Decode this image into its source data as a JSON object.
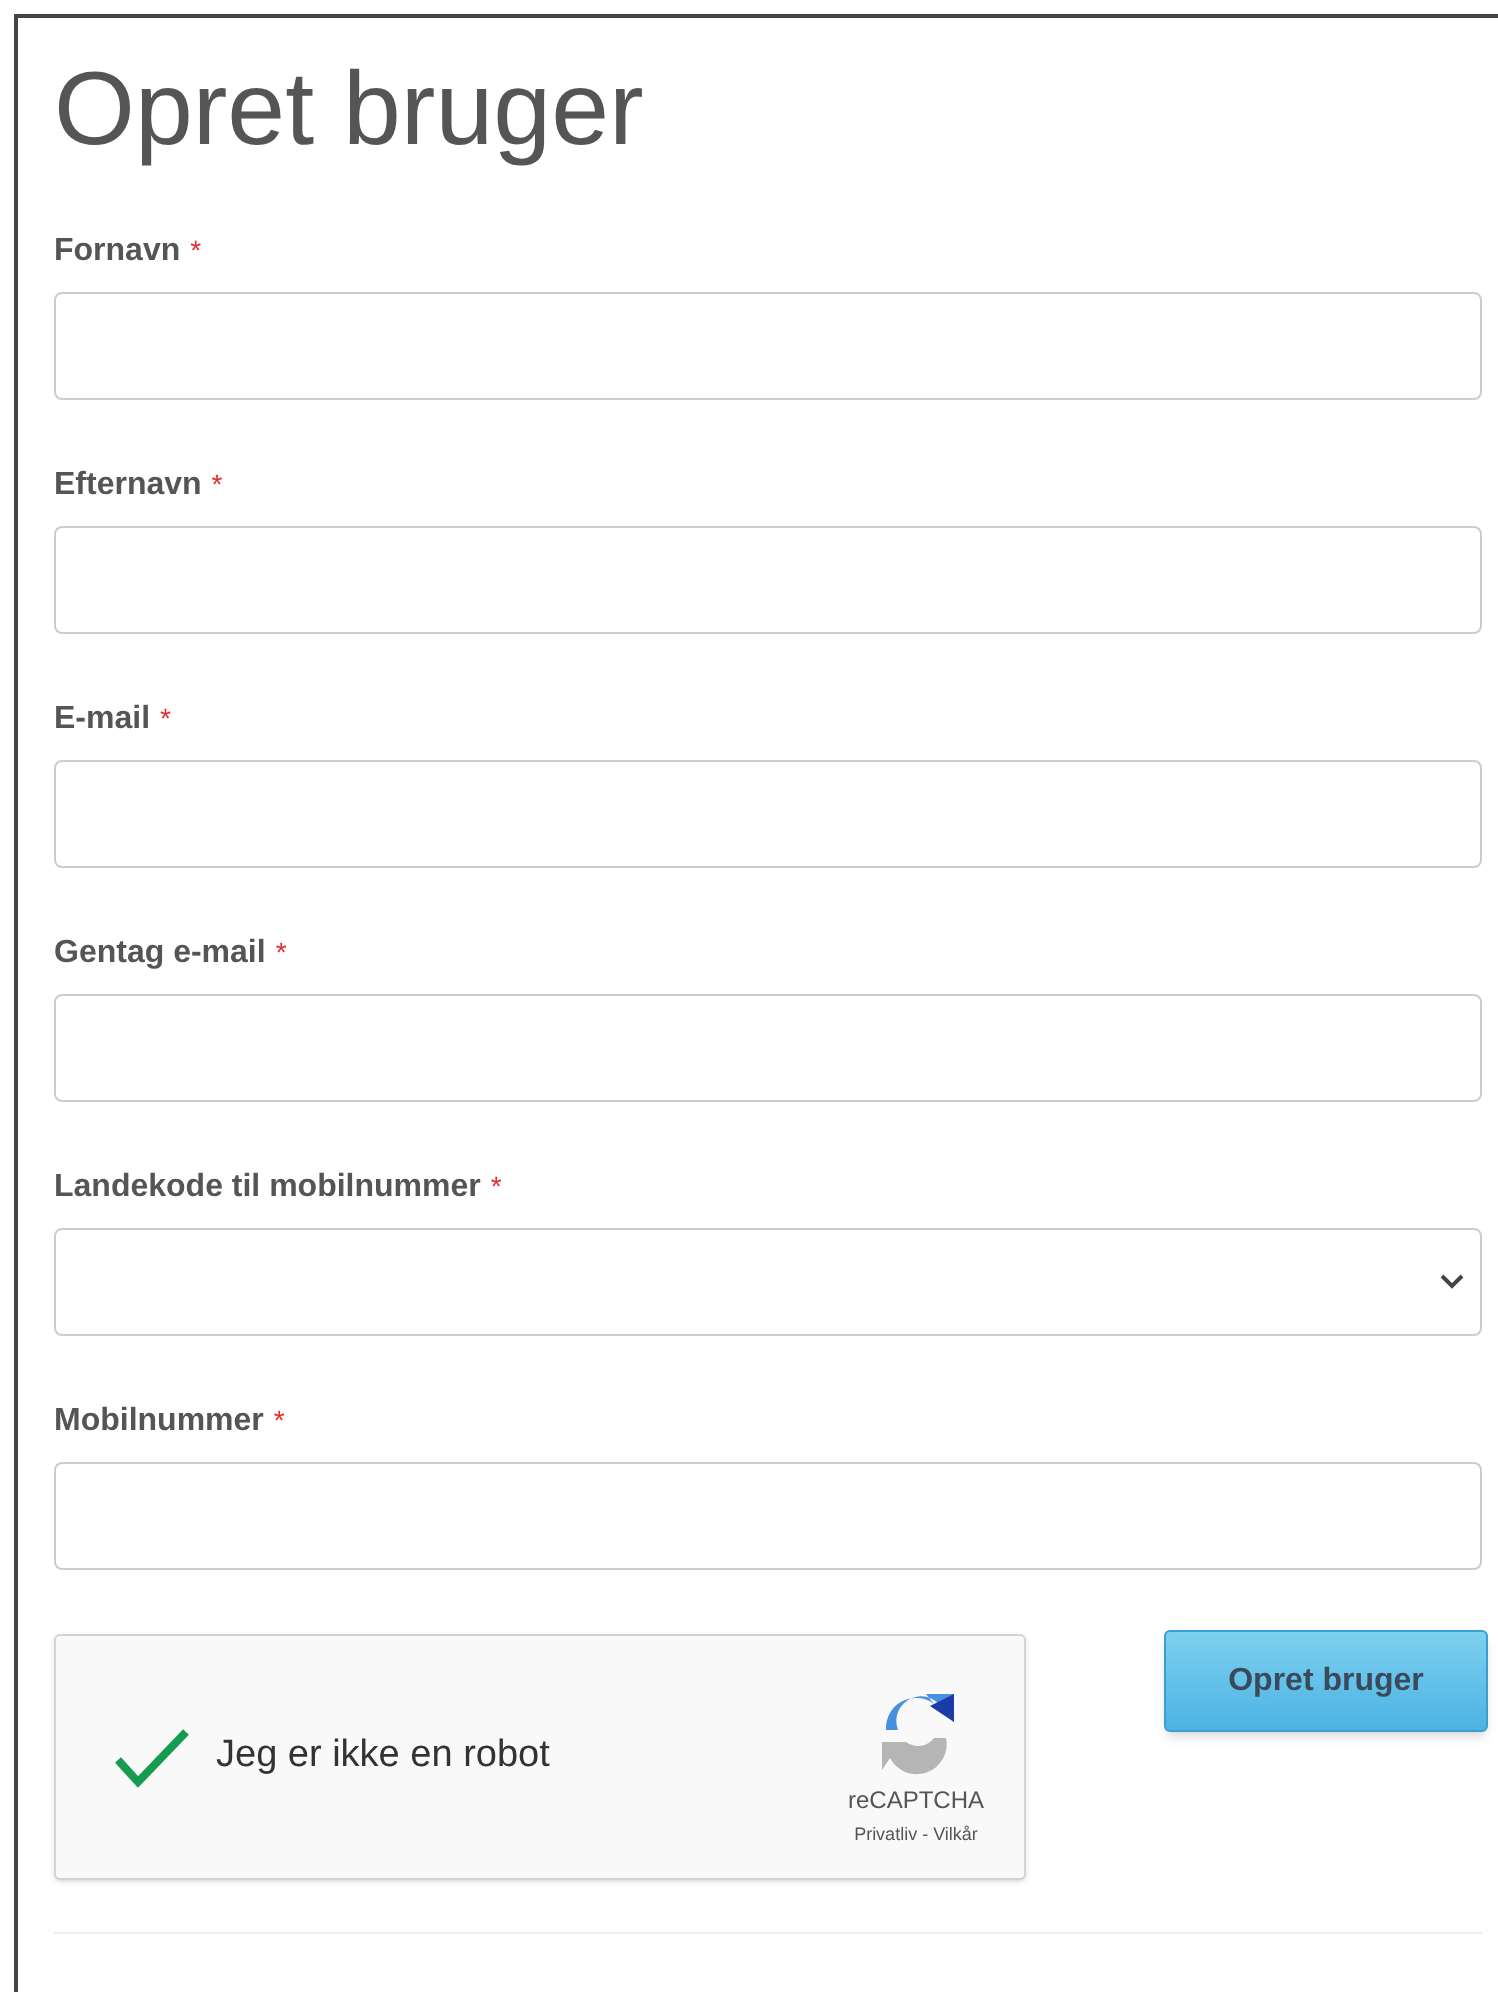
{
  "title": "Opret bruger",
  "fields": [
    {
      "label": "Fornavn",
      "required": true,
      "kind": "text"
    },
    {
      "label": "Efternavn",
      "required": true,
      "kind": "text"
    },
    {
      "label": "E-mail",
      "required": true,
      "kind": "text"
    },
    {
      "label": "Gentag e-mail",
      "required": true,
      "kind": "text"
    },
    {
      "label": "Landekode til mobilnummer",
      "required": true,
      "kind": "select"
    },
    {
      "label": "Mobilnummer",
      "required": true,
      "kind": "text"
    }
  ],
  "required_mark": "*",
  "captcha": {
    "label": "Jeg er ikke en robot",
    "checked": true,
    "brand": "reCAPTCHA",
    "links": "Privatliv - Vilkår"
  },
  "submit_button": "Opret bruger"
}
